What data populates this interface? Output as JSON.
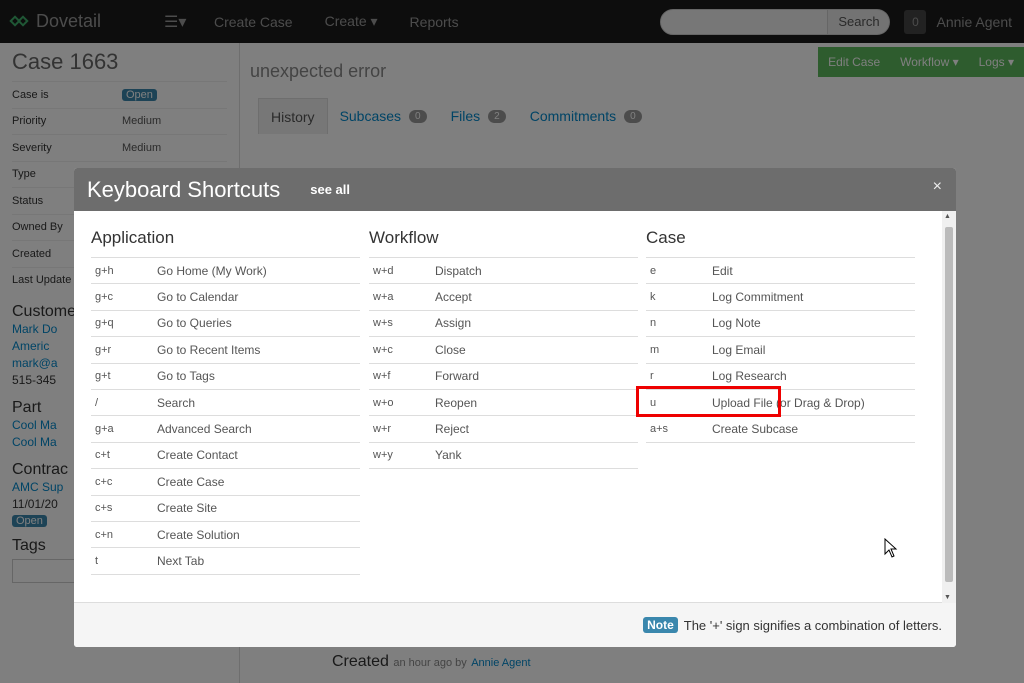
{
  "nav": {
    "brand": "Dovetail",
    "menu_icon": "list-icon",
    "links": [
      "Create Case",
      "Create",
      "Reports"
    ],
    "search_label": "Search",
    "notifications": "0",
    "user": "Annie Agent"
  },
  "sidebar": {
    "case_title": "Case 1663",
    "props": [
      {
        "label": "Case is",
        "value": "Open"
      },
      {
        "label": "Priority",
        "value": "Medium"
      },
      {
        "label": "Severity",
        "value": "Medium"
      },
      {
        "label": "Type",
        "value": ""
      },
      {
        "label": "Status",
        "value": ""
      },
      {
        "label": "Owned By",
        "value": ""
      },
      {
        "label": "Created",
        "value": ""
      },
      {
        "label": "Last Update",
        "value": ""
      }
    ],
    "customer_head": "Custome",
    "customer_lines": [
      "Mark Do",
      "Americ",
      "mark@a",
      "515-345"
    ],
    "part_head": "Part",
    "part_lines": [
      "Cool Ma",
      "Cool Ma"
    ],
    "contract_head": "Contrac",
    "contract_lines": [
      "AMC Sup",
      "11/01/20"
    ],
    "contract_status": "Open",
    "tags_head": "Tags"
  },
  "main": {
    "actions": [
      "Edit Case",
      "Workflow ▾",
      "Logs ▾"
    ],
    "subject": "unexpected error",
    "tabs": [
      {
        "label": "History",
        "count": ""
      },
      {
        "label": "Subcases",
        "count": "0"
      },
      {
        "label": "Files",
        "count": "2"
      },
      {
        "label": "Commitments",
        "count": "0"
      }
    ],
    "created_title": "Created",
    "created_time": "an hour ago by",
    "created_by": "Annie Agent"
  },
  "modal": {
    "title": "Keyboard Shortcuts",
    "see_all": "see all",
    "close": "×",
    "columns": [
      {
        "heading": "Application",
        "rows": [
          {
            "key": "g+h",
            "action": "Go Home (My Work)"
          },
          {
            "key": "g+c",
            "action": "Go to Calendar"
          },
          {
            "key": "g+q",
            "action": "Go to Queries"
          },
          {
            "key": "g+r",
            "action": "Go to Recent Items"
          },
          {
            "key": "g+t",
            "action": "Go to Tags"
          },
          {
            "key": "/",
            "action": "Search"
          },
          {
            "key": "g+a",
            "action": "Advanced Search"
          },
          {
            "key": "c+t",
            "action": "Create Contact"
          },
          {
            "key": "c+c",
            "action": "Create Case"
          },
          {
            "key": "c+s",
            "action": "Create Site"
          },
          {
            "key": "c+n",
            "action": "Create Solution"
          },
          {
            "key": "t",
            "action": "Next Tab"
          }
        ]
      },
      {
        "heading": "Workflow",
        "rows": [
          {
            "key": "w+d",
            "action": "Dispatch"
          },
          {
            "key": "w+a",
            "action": "Accept"
          },
          {
            "key": "w+s",
            "action": "Assign"
          },
          {
            "key": "w+c",
            "action": "Close"
          },
          {
            "key": "w+f",
            "action": "Forward"
          },
          {
            "key": "w+o",
            "action": "Reopen"
          },
          {
            "key": "w+r",
            "action": "Reject"
          },
          {
            "key": "w+y",
            "action": "Yank"
          }
        ]
      },
      {
        "heading": "Case",
        "rows": [
          {
            "key": "e",
            "action": "Edit"
          },
          {
            "key": "k",
            "action": "Log Commitment"
          },
          {
            "key": "n",
            "action": "Log Note"
          },
          {
            "key": "m",
            "action": "Log Email"
          },
          {
            "key": "r",
            "action": "Log Research"
          },
          {
            "key": "u",
            "action": "Upload File (or Drag & Drop)"
          },
          {
            "key": "a+s",
            "action": "Create Subcase"
          }
        ]
      }
    ],
    "note_badge": "Note",
    "note_text": "The '+' sign signifies a combination of letters."
  },
  "colors": {
    "navbar": "#1b1b1b",
    "accent": "#3a87ad",
    "highlight": "#ee0000",
    "action_bar": "#5cb85c"
  }
}
